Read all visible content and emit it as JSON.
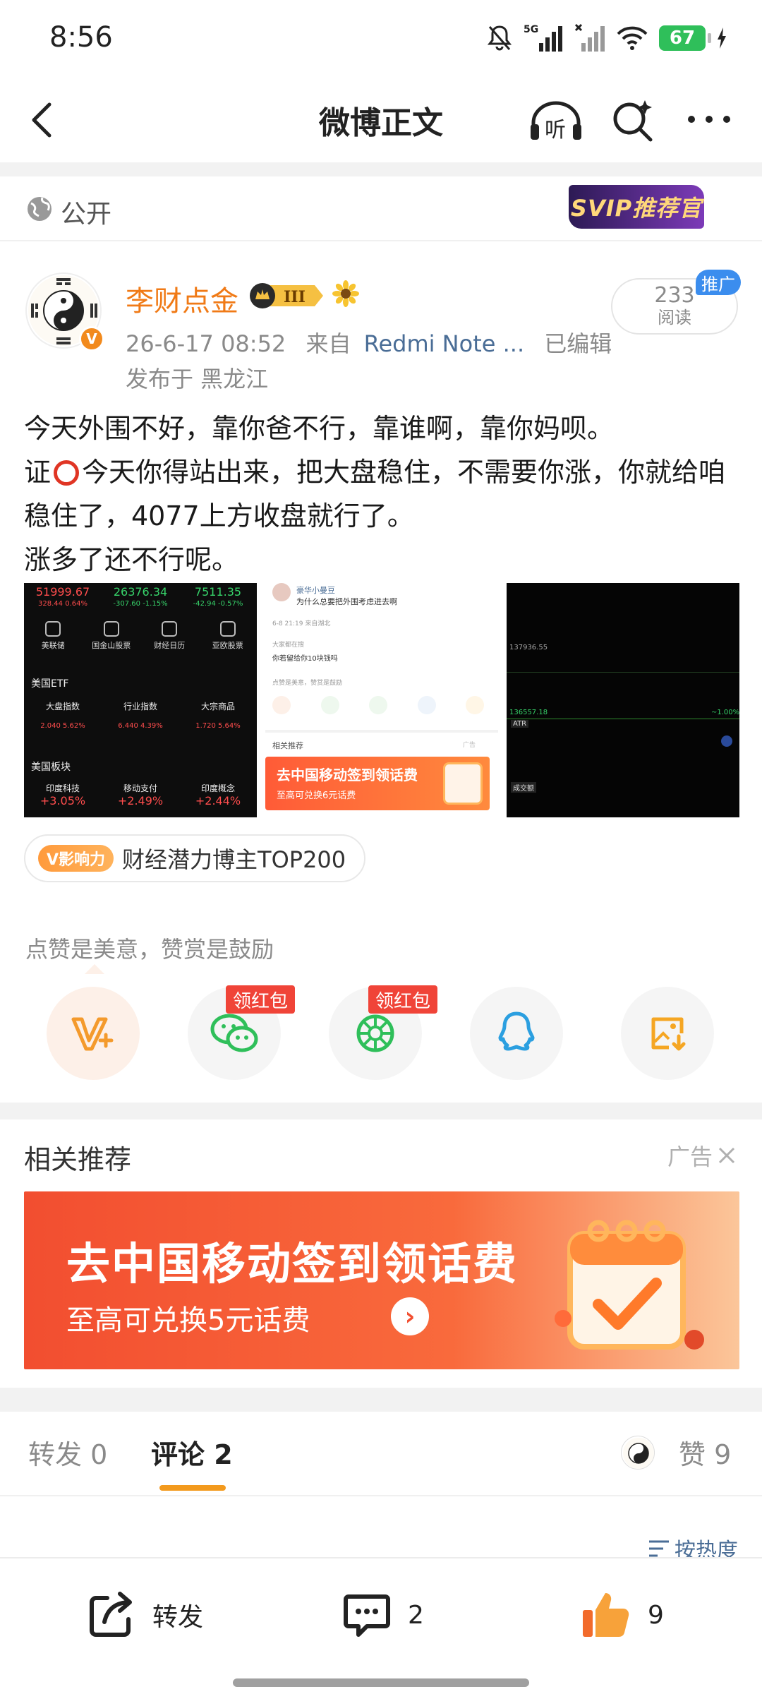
{
  "status_bar": {
    "time": "8:56",
    "network": "5G",
    "battery": "67"
  },
  "header": {
    "title": "微博正文",
    "listen_label": "听"
  },
  "visibility": {
    "label": "公开",
    "svip_badge": "SVIP推荐官"
  },
  "author": {
    "name": "李财点金",
    "level_badge": "III",
    "date": "26-6-17 08:52",
    "source_prefix": "来自",
    "device": "Redmi Note ...",
    "edited": "已编辑",
    "location": "发布于 黑龙江",
    "reads": "233",
    "reads_label": "阅读",
    "promo_tag": "推广"
  },
  "post": {
    "line1": "今天外围不好，靠你爸不行，靠谁啊，靠你妈呗。",
    "line2a": "证",
    "line2b": "今天你得站出来，把大盘稳住，不需要你涨，你就给咱稳住了，4077上方收盘就行了。",
    "line3": "涨多了还不行呢。"
  },
  "image1": {
    "top_values": [
      "51999.67",
      "26376.34",
      "7511.35"
    ],
    "top_changes": [
      "328.44  0.64%",
      "-307.60  -1.15%",
      "-42.94  -0.57%"
    ],
    "nav": [
      "美联储",
      "国金山股票",
      "财经日历",
      "亚欧股票"
    ],
    "etf_title": "美国ETF",
    "etf_names": [
      "大盘指数",
      "行业指数",
      "大宗商品"
    ],
    "etf_values": [
      "2.040  5.62%",
      "6.440  4.39%",
      "1.720  5.64%"
    ],
    "sector_title": "美国板块",
    "sector_names": [
      "印度科技",
      "移动支付",
      "印度概念"
    ],
    "sector_values": [
      "+3.05%",
      "+2.49%",
      "+2.44%"
    ]
  },
  "image2": {
    "user": "豪华小曼豆",
    "question": "为什么总要把外围考虑进去啊",
    "time": "6-8 21:19  来自湖北",
    "search_tip": "大家都在搜",
    "search_query": "你若留给你10块钱吗",
    "reward": "点赞是美意，赞赏是鼓励",
    "related": "相关推荐",
    "ad": "广告",
    "banner_big": "去中国移动签到领话费",
    "banner_small": "至高可兑换6元话费"
  },
  "image3": {
    "price": "137936.55",
    "price2": "136557.18",
    "pct": "~1.00%",
    "atr": "ATR",
    "vol": "成交额"
  },
  "influence": {
    "tag": "V影响力",
    "label": "财经潜力博主TOP200"
  },
  "reward": {
    "label": "点赞是美意，赞赏是鼓励",
    "red_packet_1": "领红包",
    "red_packet_2": "领红包"
  },
  "share_icons": [
    "v-plus-icon",
    "wechat-icon",
    "moments-icon",
    "qq-icon",
    "save-image-icon"
  ],
  "related": {
    "title": "相关推荐",
    "ad_label": "广告",
    "banner_big": "去中国移动签到领话费",
    "banner_small": "至高可兑换5元话费"
  },
  "tabs": {
    "forward_label": "转发",
    "forward_count": "0",
    "comment_label": "评论",
    "comment_count": "2",
    "like_label": "赞",
    "like_count": "9"
  },
  "sort": {
    "label": "按热度"
  },
  "bottom_bar": {
    "forward": "转发",
    "comments": "2",
    "likes": "9"
  },
  "colors": {
    "accent_orange": "#f07a16",
    "tab_underline": "#f39a1d",
    "red_packet": "#f04438",
    "link_blue": "#4a6d96"
  }
}
